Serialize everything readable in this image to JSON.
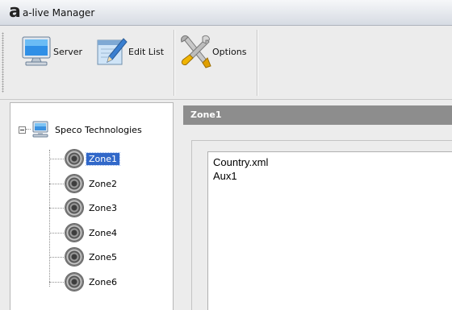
{
  "window": {
    "logo_letter": "a",
    "title": "a-live Manager"
  },
  "toolbar": {
    "buttons": [
      {
        "label": "Server",
        "icon": "monitor-icon"
      },
      {
        "label": "Edit List",
        "icon": "edit-list-icon"
      },
      {
        "label": "Options",
        "icon": "tools-icon"
      }
    ]
  },
  "tree": {
    "root": {
      "label": "Speco Technologies",
      "icon": "computer-icon",
      "expanded": true
    },
    "zones": [
      {
        "label": "Zone1",
        "icon": "speaker-icon",
        "selected": true
      },
      {
        "label": "Zone2",
        "icon": "speaker-icon"
      },
      {
        "label": "Zone3",
        "icon": "speaker-icon"
      },
      {
        "label": "Zone4",
        "icon": "speaker-icon"
      },
      {
        "label": "Zone5",
        "icon": "speaker-icon"
      },
      {
        "label": "Zone6",
        "icon": "speaker-icon"
      }
    ]
  },
  "panel": {
    "title": "Zone1",
    "items": [
      "Country.xml",
      "Aux1"
    ]
  },
  "colors": {
    "selection": "#3168c9",
    "panel_header": "#8d8d8d"
  }
}
